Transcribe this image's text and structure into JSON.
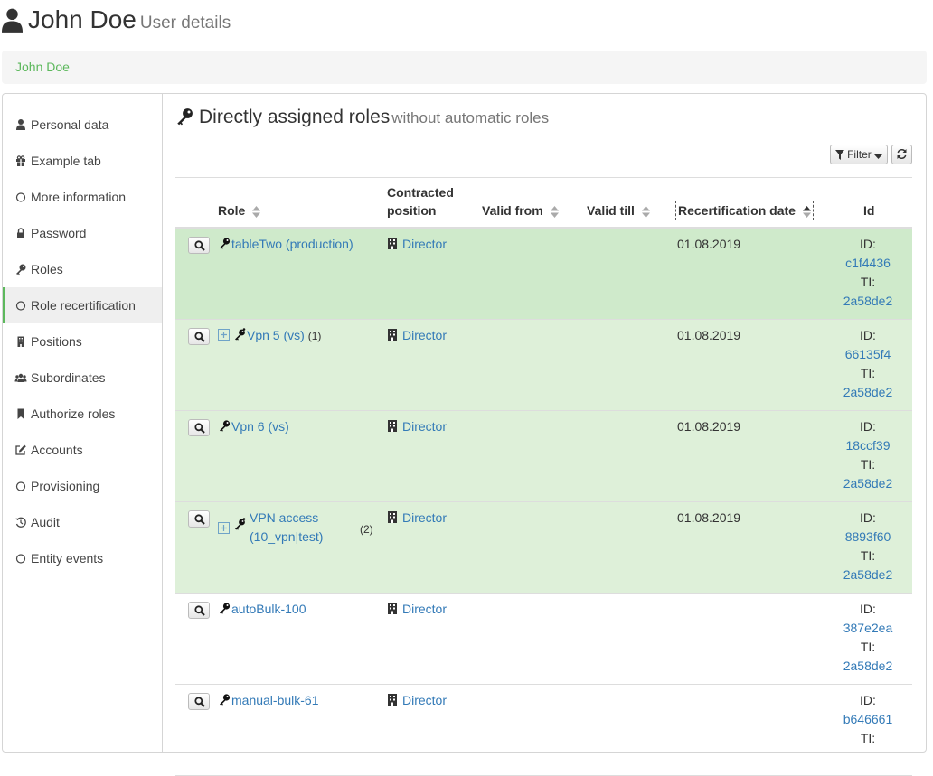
{
  "header": {
    "title": "John Doe",
    "subtitle": "User details"
  },
  "breadcrumb": {
    "label": "John Doe"
  },
  "sidebar": {
    "items": [
      {
        "label": "Personal data",
        "icon": "user-icon"
      },
      {
        "label": "Example tab",
        "icon": "gift-icon"
      },
      {
        "label": "More information",
        "icon": "circle-icon"
      },
      {
        "label": "Password",
        "icon": "lock-icon"
      },
      {
        "label": "Roles",
        "icon": "key-icon"
      },
      {
        "label": "Role recertification",
        "icon": "circle-icon",
        "active": true
      },
      {
        "label": "Positions",
        "icon": "building-icon"
      },
      {
        "label": "Subordinates",
        "icon": "users-icon"
      },
      {
        "label": "Authorize roles",
        "icon": "bookmark-icon"
      },
      {
        "label": "Accounts",
        "icon": "edit-icon"
      },
      {
        "label": "Provisioning",
        "icon": "circle-icon"
      },
      {
        "label": "Audit",
        "icon": "history-icon"
      },
      {
        "label": "Entity events",
        "icon": "circle-icon"
      }
    ]
  },
  "section": {
    "title": "Directly assigned roles",
    "subtitle": "without automatic roles"
  },
  "toolbar": {
    "filter_label": "Filter"
  },
  "table": {
    "columns": {
      "role": "Role",
      "position_line1": "Contracted",
      "position_line2": "position",
      "valid_from": "Valid from",
      "valid_till": "Valid till",
      "recertification": "Recertification date",
      "id": "Id"
    },
    "rows": [
      {
        "role": "tableTwo (production)",
        "count": "",
        "position": "Director",
        "recert": "01.08.2019",
        "id_label": "ID:",
        "id": "c1f4436",
        "ti_label": "TI:",
        "ti": "2a58de2",
        "style": "highlight"
      },
      {
        "role": "Vpn 5 (vs)",
        "count": "(1)",
        "position": "Director",
        "recert": "01.08.2019",
        "id_label": "ID:",
        "id": "66135f4",
        "ti_label": "TI:",
        "ti": "2a58de2",
        "style": "success"
      },
      {
        "role": "Vpn 6 (vs)",
        "count": "",
        "position": "Director",
        "recert": "01.08.2019",
        "id_label": "ID:",
        "id": "18ccf39",
        "ti_label": "TI:",
        "ti": "2a58de2",
        "style": "success"
      },
      {
        "role_line1": "VPN access",
        "role_line2": "(10_vpn|test)",
        "count": "(2)",
        "position": "Director",
        "recert": "01.08.2019",
        "id_label": "ID:",
        "id": "8893f60",
        "ti_label": "TI:",
        "ti": "2a58de2",
        "style": "success"
      },
      {
        "role": "autoBulk-100",
        "count": "",
        "position": "Director",
        "recert": "",
        "id_label": "ID:",
        "id": "387e2ea",
        "ti_label": "TI:",
        "ti": "2a58de2",
        "style": "none"
      },
      {
        "role": "manual-bulk-61",
        "count": "",
        "position": "Director",
        "recert": "",
        "id_label": "ID:",
        "id": "b646661",
        "ti_label": "TI:",
        "ti": "",
        "style": "none"
      }
    ]
  }
}
